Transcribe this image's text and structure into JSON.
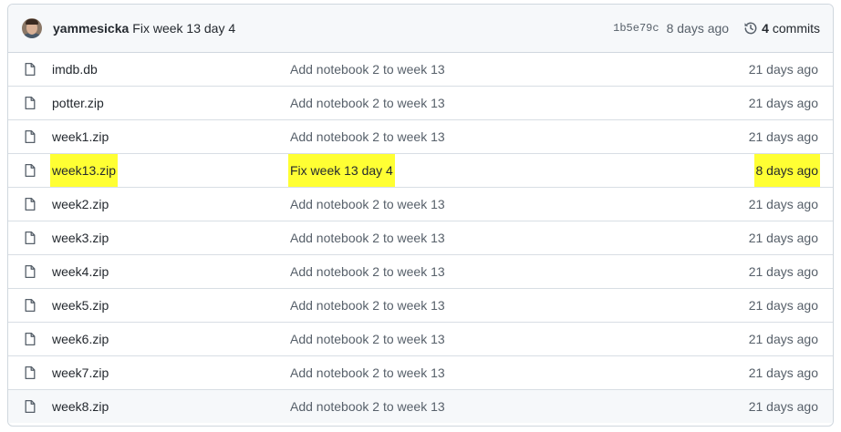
{
  "latest_commit": {
    "author": "yammesicka",
    "message": "Fix week 13 day 4",
    "sha": "1b5e79c",
    "time": "8 days ago",
    "commit_count": "4",
    "commits_label": "commits"
  },
  "files": [
    {
      "name": "imdb.db",
      "message": "Add notebook 2 to week 13",
      "age": "21 days ago"
    },
    {
      "name": "potter.zip",
      "message": "Add notebook 2 to week 13",
      "age": "21 days ago"
    },
    {
      "name": "week1.zip",
      "message": "Add notebook 2 to week 13",
      "age": "21 days ago"
    },
    {
      "name": "week13.zip",
      "message": "Fix week 13 day 4",
      "age": "8 days ago"
    },
    {
      "name": "week2.zip",
      "message": "Add notebook 2 to week 13",
      "age": "21 days ago"
    },
    {
      "name": "week3.zip",
      "message": "Add notebook 2 to week 13",
      "age": "21 days ago"
    },
    {
      "name": "week4.zip",
      "message": "Add notebook 2 to week 13",
      "age": "21 days ago"
    },
    {
      "name": "week5.zip",
      "message": "Add notebook 2 to week 13",
      "age": "21 days ago"
    },
    {
      "name": "week6.zip",
      "message": "Add notebook 2 to week 13",
      "age": "21 days ago"
    },
    {
      "name": "week7.zip",
      "message": "Add notebook 2 to week 13",
      "age": "21 days ago"
    },
    {
      "name": "week8.zip",
      "message": "Add notebook 2 to week 13",
      "age": "21 days ago"
    }
  ],
  "highlight_color": "#ffff33",
  "icons": {
    "file": "file-icon",
    "history": "history-icon"
  }
}
